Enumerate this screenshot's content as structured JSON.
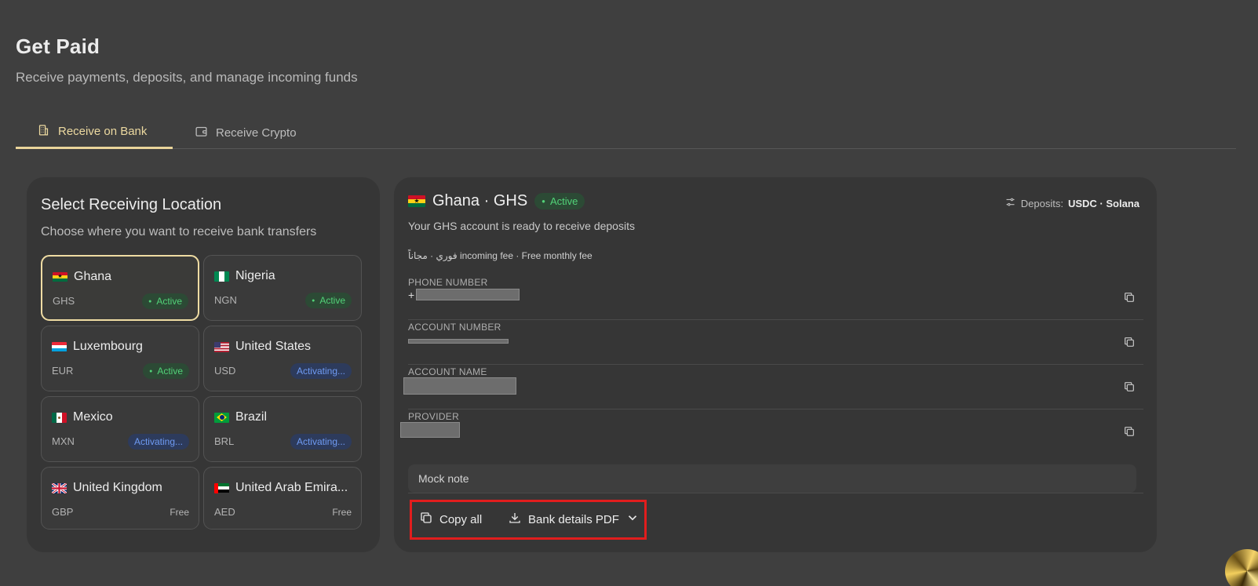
{
  "header": {
    "title": "Get Paid",
    "subtitle": "Receive payments, deposits, and manage incoming funds"
  },
  "tabs": [
    {
      "label": "Receive on Bank",
      "icon": "bank-building-icon",
      "active": true
    },
    {
      "label": "Receive Crypto",
      "icon": "wallet-icon",
      "active": false
    }
  ],
  "locations": {
    "title": "Select Receiving Location",
    "subtitle": "Choose where you want to receive bank transfers",
    "items": [
      {
        "name": "Ghana",
        "currency": "GHS",
        "status": "Active"
      },
      {
        "name": "Nigeria",
        "currency": "NGN",
        "status": "Active"
      },
      {
        "name": "Luxembourg",
        "currency": "EUR",
        "status": "Active"
      },
      {
        "name": "United States",
        "currency": "USD",
        "status": "Activating..."
      },
      {
        "name": "Mexico",
        "currency": "MXN",
        "status": "Activating..."
      },
      {
        "name": "Brazil",
        "currency": "BRL",
        "status": "Activating..."
      },
      {
        "name": "United Kingdom",
        "currency": "GBP",
        "status": "Free"
      },
      {
        "name": "United Arab Emira...",
        "currency": "AED",
        "status": "Free"
      }
    ]
  },
  "account": {
    "country": "Ghana · GHS",
    "status": "Active",
    "deposits_label": "Deposits:",
    "deposits_value": "USDC · Solana",
    "ready_text": "Your GHS account is ready to receive deposits",
    "fee_text": "فوري · مجاناً incoming fee · Free monthly fee",
    "fields": [
      {
        "label": "PHONE NUMBER",
        "value": "+"
      },
      {
        "label": "ACCOUNT NUMBER",
        "value": ""
      },
      {
        "label": "ACCOUNT NAME",
        "value": ""
      },
      {
        "label": "PROVIDER",
        "value": ""
      }
    ],
    "note": "Mock note",
    "actions": {
      "copy_all": "Copy all",
      "pdf": "Bank details PDF"
    }
  },
  "colors": {
    "accent": "#e9d49a",
    "active_green": "#52d278",
    "activating_blue": "#6f9bf3",
    "highlight_red": "#e11d1d"
  }
}
